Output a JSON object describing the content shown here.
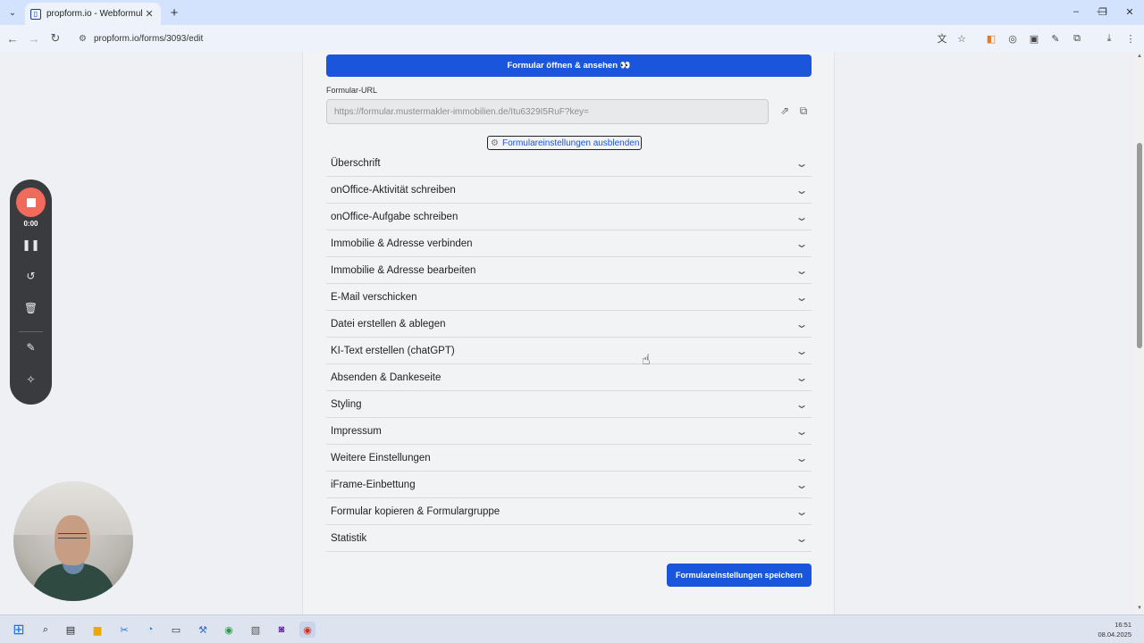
{
  "browser": {
    "tab_title": "propform.io - Webformular-Ba",
    "url": "propform.io/forms/3093/edit",
    "colors": {
      "tabbar": "#d3e3fd",
      "toolbar": "#eef3fb"
    }
  },
  "page": {
    "open_button_label": "Formular öffnen & ansehen 👀",
    "url_label": "Formular-URL",
    "url_value": "https://formular.mustermakler-immobilien.de/Itu6329I5RuF?key=",
    "hide_settings_label": "Formulareinstellungen ausblenden",
    "sections": [
      "Überschrift",
      "onOffice-Aktivität schreiben",
      "onOffice-Aufgabe schreiben",
      "Immobilie & Adresse verbinden",
      "Immobilie & Adresse bearbeiten",
      "E-Mail verschicken",
      "Datei erstellen & ablegen",
      "KI-Text erstellen (chatGPT)",
      "Absenden & Dankeseite",
      "Styling",
      "Impressum",
      "Weitere Einstellungen",
      "iFrame-Einbettung",
      "Formular kopieren & Formulargruppe",
      "Statistik"
    ],
    "save_button_label": "Formulareinstellungen speichern",
    "colors": {
      "primary": "#1a56db"
    }
  },
  "recorder": {
    "time": "0:00",
    "stop_color": "#f06b5c"
  },
  "taskbar": {
    "time": "16:51",
    "date": "08.04.2025"
  }
}
